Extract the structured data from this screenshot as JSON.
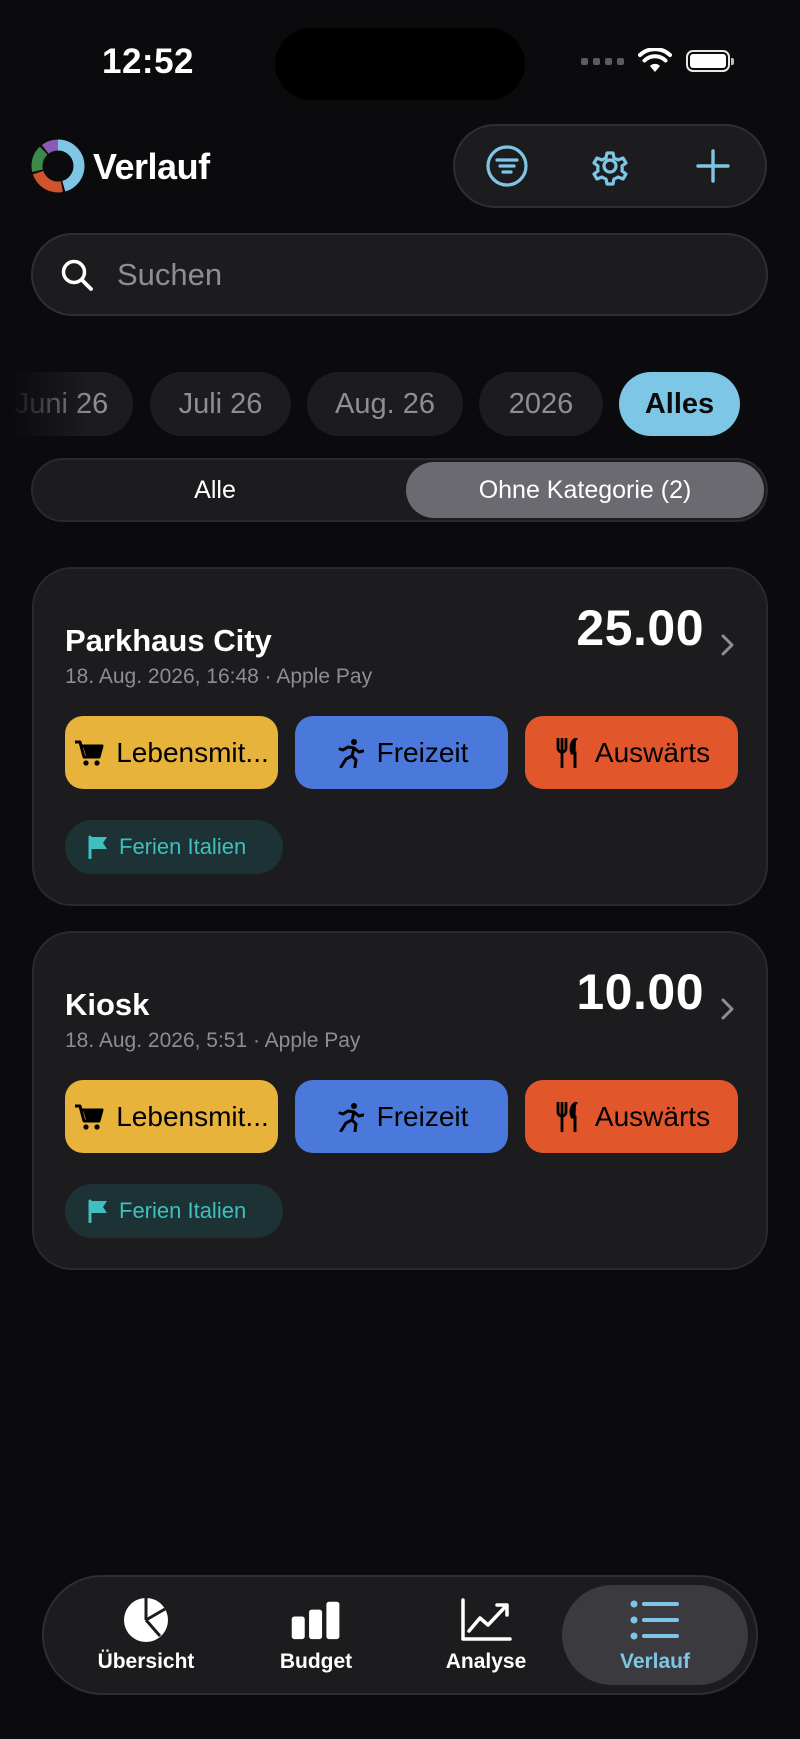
{
  "status": {
    "time": "12:52"
  },
  "header": {
    "title": "Verlauf",
    "actions": [
      "filter-icon",
      "gear-icon",
      "plus-icon"
    ]
  },
  "search": {
    "placeholder": "Suchen"
  },
  "periods": [
    "Juni 26",
    "Juli 26",
    "Aug. 26",
    "2026",
    "Alles"
  ],
  "periods_selected": "Alles",
  "segment": {
    "all": "Alle",
    "uncategorized": "Ohne Kategorie (2)",
    "selected": "uncategorized"
  },
  "transactions": [
    {
      "name": "Parkhaus City",
      "meta": "18. Aug. 2026, 16:48 · Apple Pay",
      "amount": "25.00",
      "categories": [
        {
          "label": "Lebensmit...",
          "icon": "cart-icon",
          "color": "#e8b33a"
        },
        {
          "label": "Freizeit",
          "icon": "running-icon",
          "color": "#4b78db"
        },
        {
          "label": "Auswärts",
          "icon": "fork-knife-icon",
          "color": "#e2562c"
        }
      ],
      "trip": "Ferien Italien"
    },
    {
      "name": "Kiosk",
      "meta": "18. Aug. 2026, 5:51 · Apple Pay",
      "amount": "10.00",
      "categories": [
        {
          "label": "Lebensmit...",
          "icon": "cart-icon",
          "color": "#e8b33a"
        },
        {
          "label": "Freizeit",
          "icon": "running-icon",
          "color": "#4b78db"
        },
        {
          "label": "Auswärts",
          "icon": "fork-knife-icon",
          "color": "#e2562c"
        }
      ],
      "trip": "Ferien Italien"
    }
  ],
  "tabbar": {
    "tabs": [
      {
        "label": "Übersicht",
        "icon": "pie-chart-icon"
      },
      {
        "label": "Budget",
        "icon": "bar-chart-icon"
      },
      {
        "label": "Analyse",
        "icon": "line-chart-icon"
      },
      {
        "label": "Verlauf",
        "icon": "list-icon"
      }
    ],
    "active": "Verlauf"
  },
  "colors": {
    "accent": "#7ec6e6",
    "background": "#0b0b0d",
    "card": "#1c1c1f"
  }
}
